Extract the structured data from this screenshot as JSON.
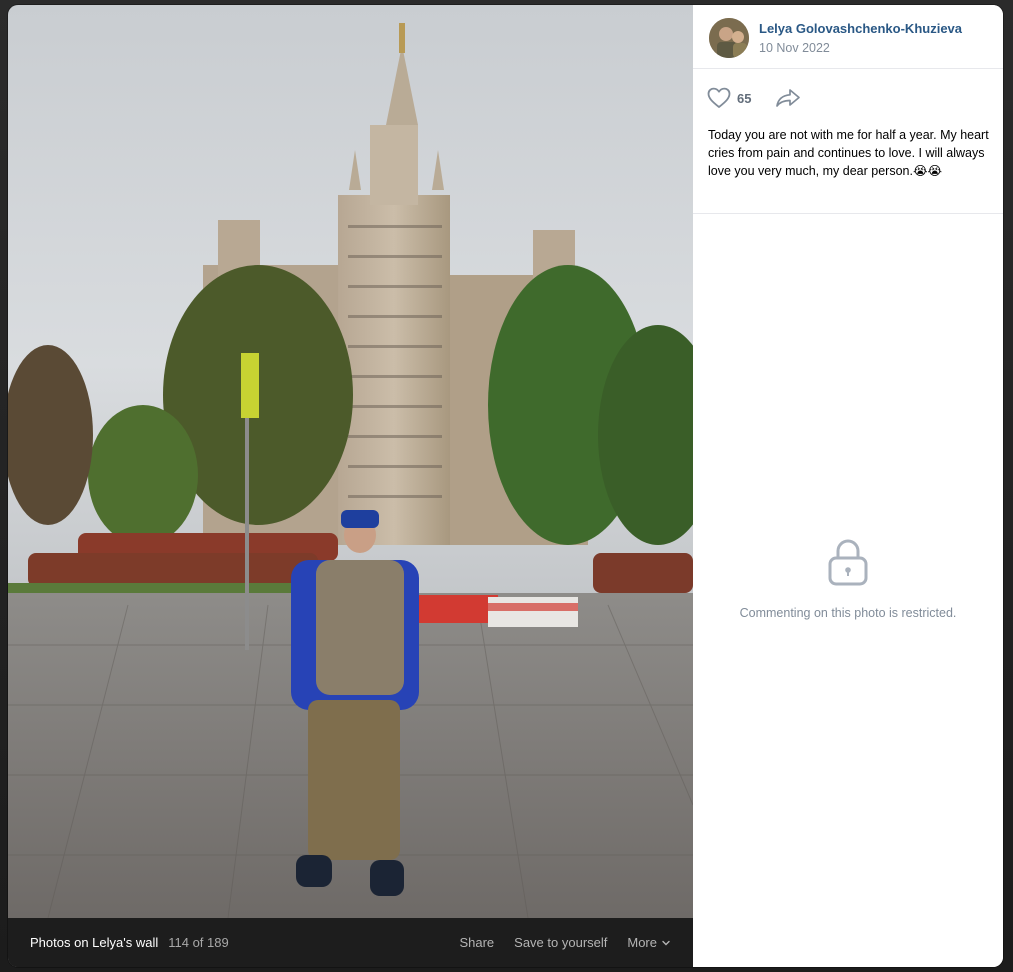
{
  "photo": {
    "description_icon": "photo-kotelnicheskaya-embankment-building"
  },
  "footer": {
    "album_title": "Photos on Lelya's wall",
    "counter": "114 of 189",
    "share_label": "Share",
    "save_label": "Save to yourself",
    "more_label": "More"
  },
  "post": {
    "author_name": "Lelya Golovashchenko-Khuzieva",
    "date": "10 Nov 2022",
    "likes": "65",
    "caption": "Today you are not with me for half a year. My heart cries from pain and continues to love. I will always love you very much, my dear person.😭😭"
  },
  "comments": {
    "restricted_text": "Commenting on this photo is restricted."
  },
  "colors": {
    "author_link": "#2a5885",
    "muted_text": "#818c99",
    "footer_bg": "#1d1d1d"
  }
}
